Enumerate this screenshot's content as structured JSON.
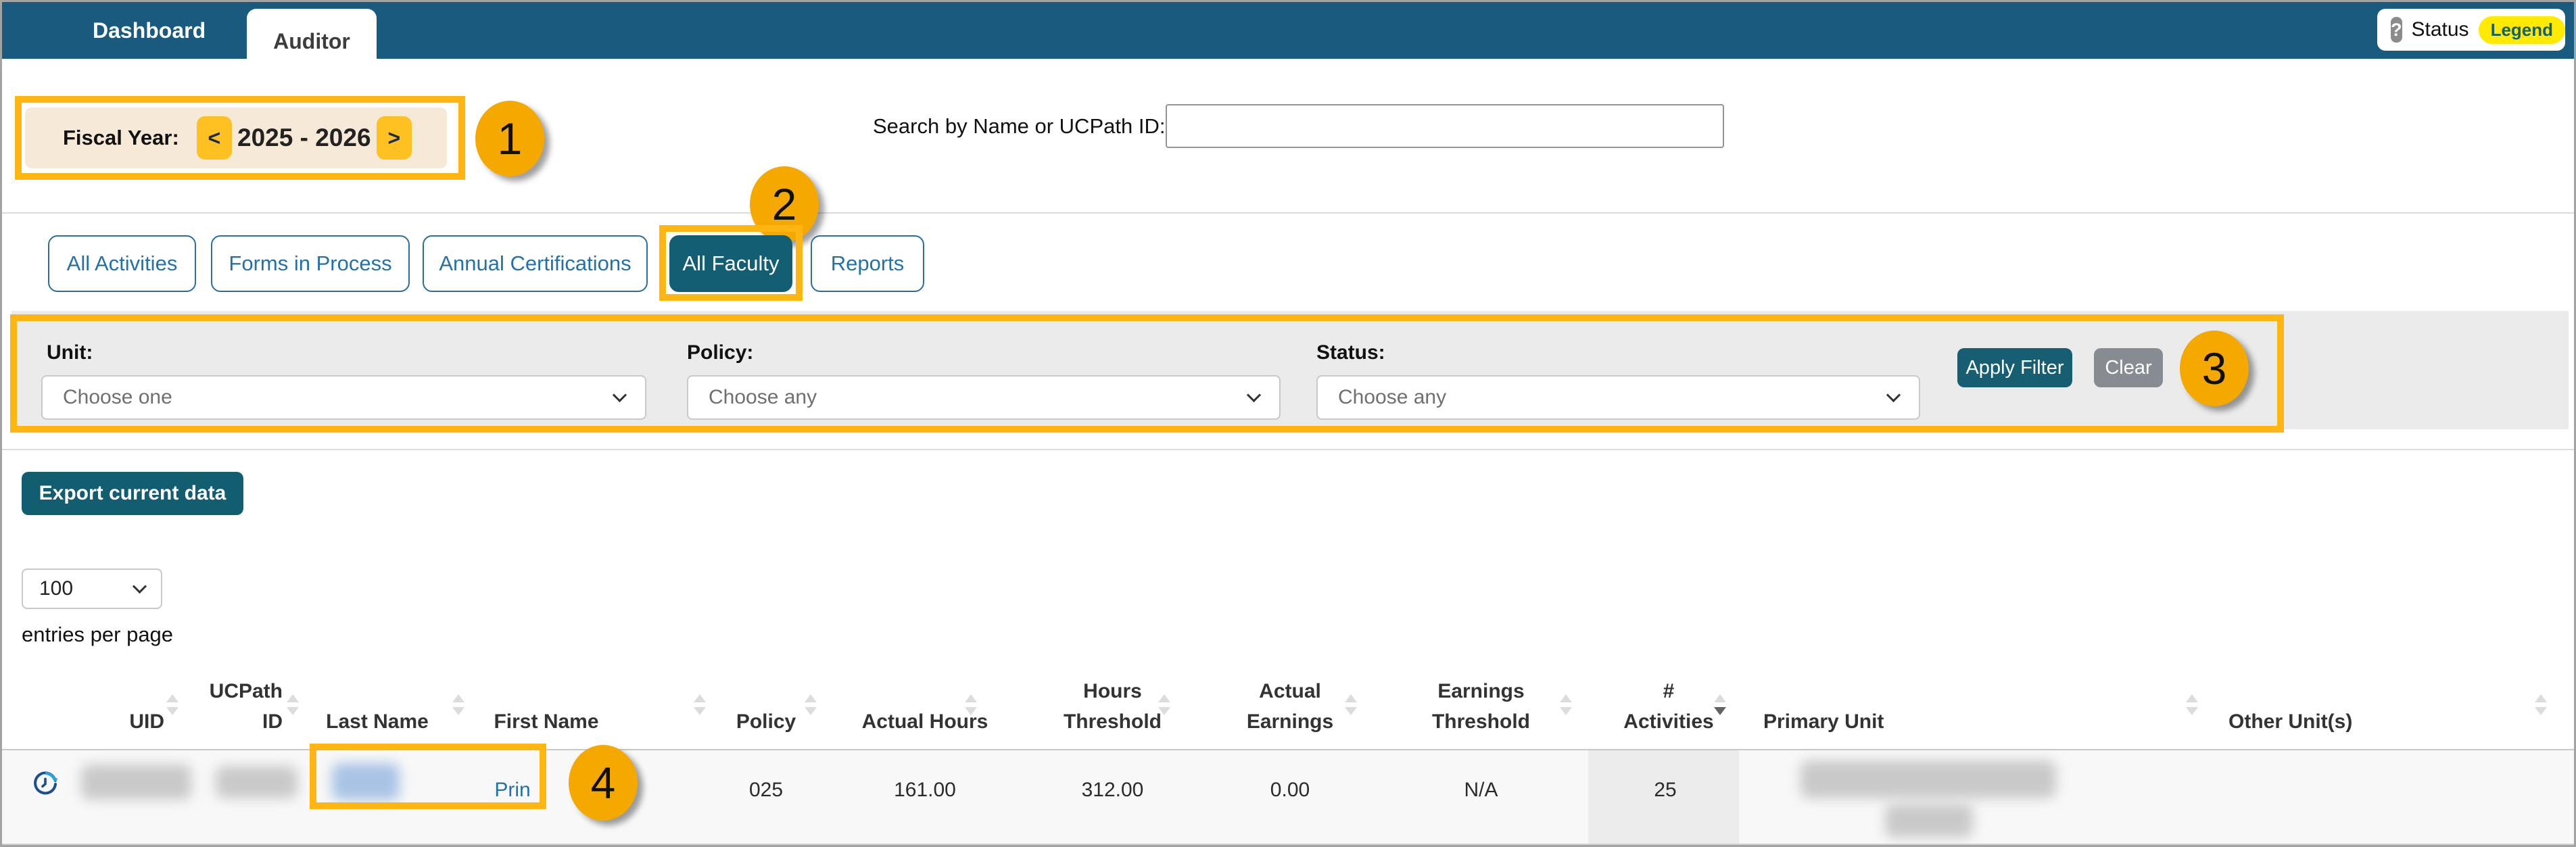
{
  "topbar": {
    "dashboard": "Dashboard",
    "auditor": "Auditor",
    "help_icon": "?",
    "status": "Status",
    "legend": "Legend"
  },
  "fiscal_year": {
    "label": "Fiscal Year:",
    "value": "2025 - 2026",
    "prev": "<",
    "next": ">"
  },
  "search": {
    "label": "Search by Name or UCPath ID:",
    "value": ""
  },
  "callouts": [
    "1",
    "2",
    "3",
    "4"
  ],
  "tabs": [
    "All Activities",
    "Forms in Process",
    "Annual Certifications",
    "All Faculty",
    "Reports"
  ],
  "active_tab": "All Faculty",
  "filters": {
    "unit_label": "Unit:",
    "unit_value": "Choose one",
    "policy_label": "Policy:",
    "policy_value": "Choose any",
    "status_label": "Status:",
    "status_value": "Choose any",
    "apply": "Apply Filter",
    "clear": "Clear"
  },
  "toolbar": {
    "export": "Export current data"
  },
  "pagination": {
    "page_size": "100",
    "suffix": "entries per page"
  },
  "table": {
    "headers": [
      "UID",
      "UCPath ID",
      "Last Name",
      "First Name",
      "Policy",
      "Actual Hours",
      "Hours Threshold",
      "Actual Earnings",
      "Earnings Threshold",
      "# Activities",
      "Primary Unit",
      "Other Unit(s)"
    ],
    "sorted_by": "# Activities",
    "sort_direction": "descending",
    "row": {
      "uid_redacted": true,
      "ucpath_id_redacted": true,
      "last_name_redacted": true,
      "first_name": "Prin",
      "policy": "025",
      "actual_hours": "161.00",
      "hours_threshold": "312.00",
      "actual_earnings": "0.00",
      "earnings_threshold": "N/A",
      "num_activities": "25",
      "primary_unit_redacted": true,
      "other_units": ""
    }
  },
  "colors": {
    "topbar": "#1A5A7E",
    "accent_button": "#145E73",
    "highlight": "#FFB612",
    "callout": "#F5A800",
    "legend_yellow": "#FFEA00"
  }
}
